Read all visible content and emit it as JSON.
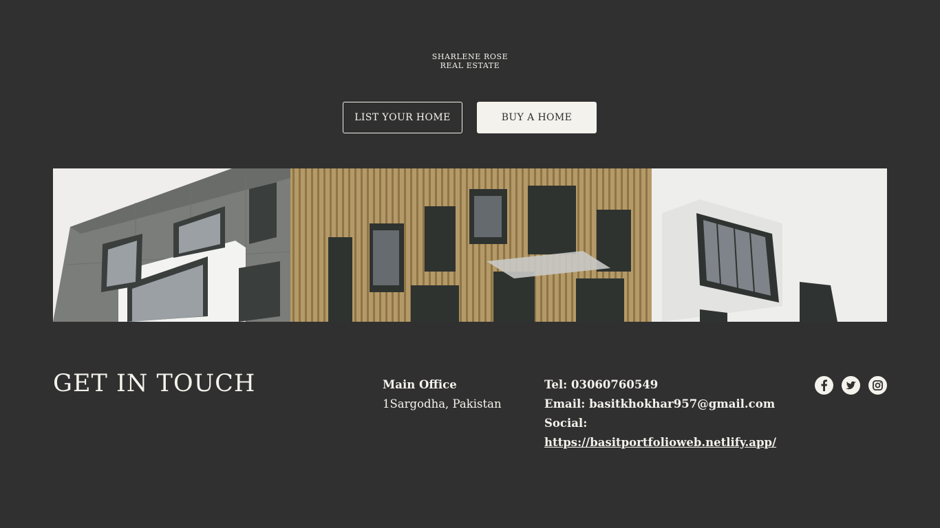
{
  "brand": {
    "line1": "SHARLENE ROSE",
    "line2": "REAL ESTATE"
  },
  "buttons": {
    "list_home": "LIST YOUR HOME",
    "buy_home": "BUY A HOME"
  },
  "hero": {
    "image": "modern apartment building facade"
  },
  "contact": {
    "heading": "GET IN TOUCH",
    "office_title": "Main Office",
    "office_address": "1Sargodha, Pakistan",
    "tel": "Tel: 03060760549",
    "email": "Email: basitkhokhar957@gmail.com",
    "social_label": "Social:",
    "social_link": "https://basitportfolioweb.netlify.app/"
  },
  "social_icons": [
    "facebook-icon",
    "twitter-icon",
    "instagram-icon"
  ],
  "colors": {
    "background": "#303030",
    "text": "#f4f2ec",
    "button_fill": "#f4f2ec"
  }
}
